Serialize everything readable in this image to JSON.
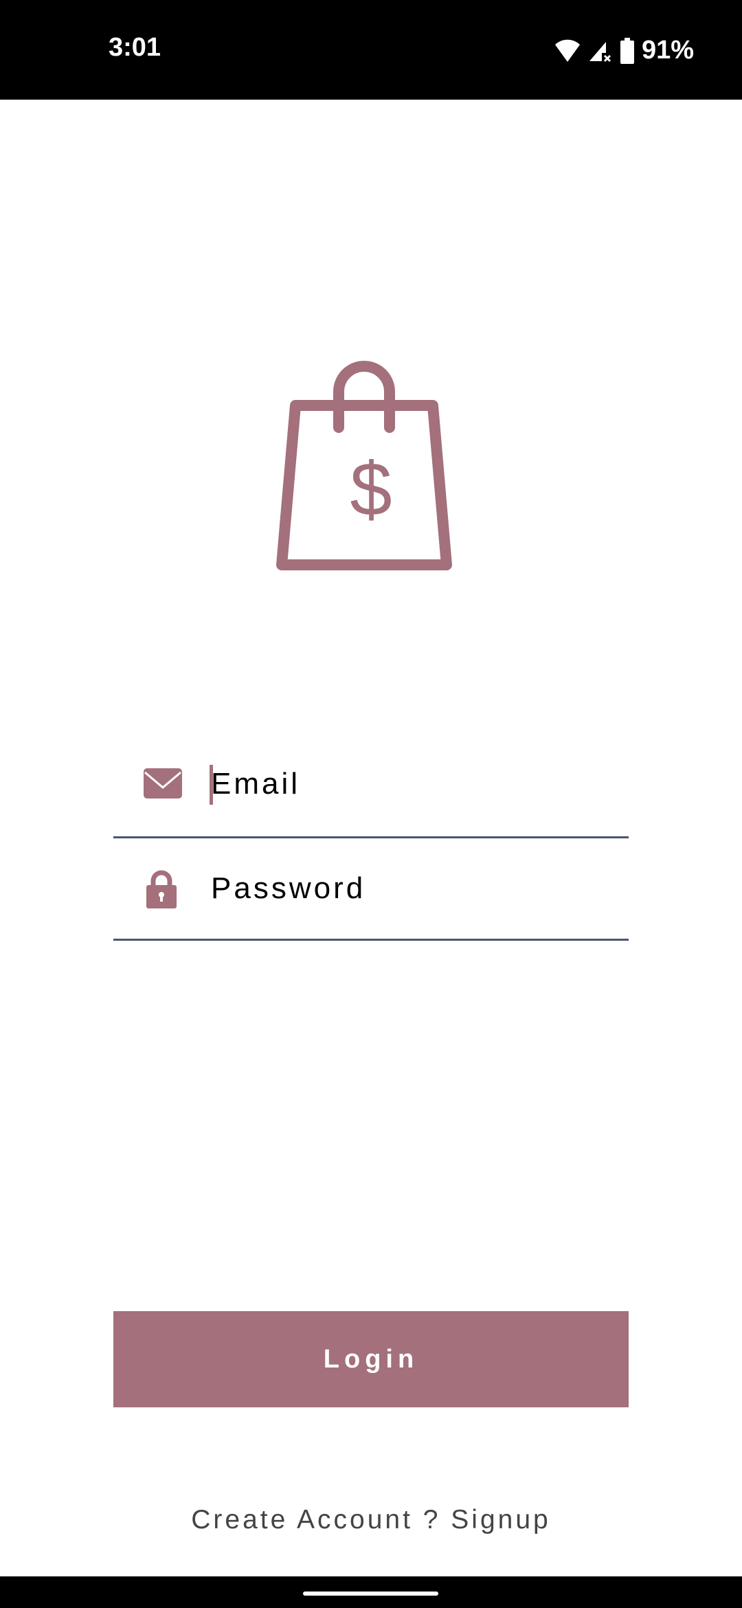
{
  "status_bar": {
    "time": "3:01",
    "battery": "91%"
  },
  "login": {
    "email_placeholder": "Email",
    "password_placeholder": "Password",
    "login_label": "Login",
    "signup_text": "Create Account ? Signup"
  },
  "colors": {
    "accent": "#a3707c",
    "underline": "#4a5570"
  }
}
